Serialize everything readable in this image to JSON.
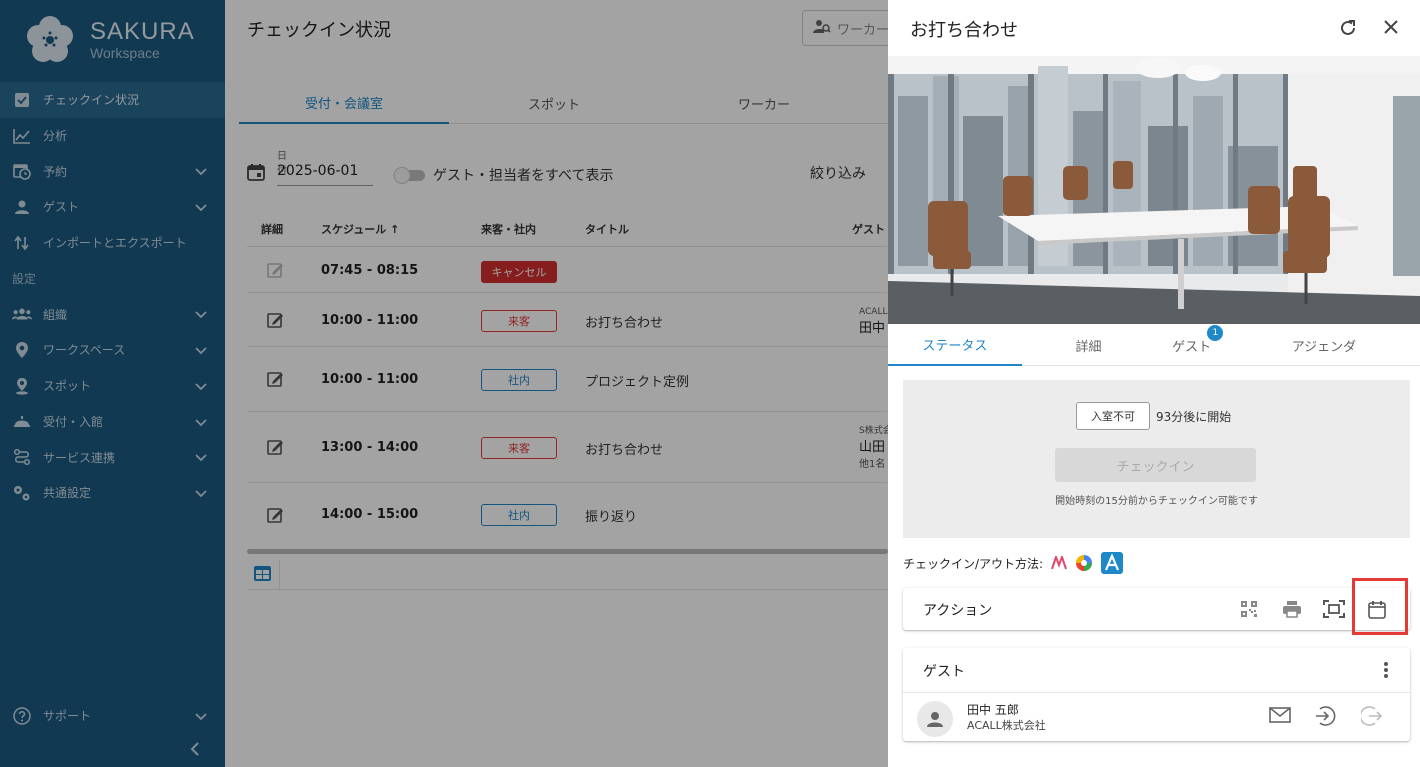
{
  "sidebar": {
    "brand": "SAKURA",
    "brand_sub": "Workspace",
    "items": [
      {
        "label": "チェックイン状況",
        "icon": "checkbox-icon",
        "active": true
      },
      {
        "label": "分析",
        "icon": "chart-line-icon"
      },
      {
        "label": "予約",
        "icon": "calendar-clock-icon",
        "expandable": true
      },
      {
        "label": "ゲスト",
        "icon": "people-icon",
        "expandable": true
      },
      {
        "label": "インポートとエクスポート",
        "icon": "import-export-icon"
      }
    ],
    "section_label": "設定",
    "settings_items": [
      {
        "label": "組織",
        "icon": "group-icon",
        "expandable": true
      },
      {
        "label": "ワークスペース",
        "icon": "location-pin-icon",
        "expandable": true
      },
      {
        "label": "スポット",
        "icon": "spot-pin-icon",
        "expandable": true
      },
      {
        "label": "受付・入館",
        "icon": "reception-bell-icon",
        "expandable": true
      },
      {
        "label": "サービス連携",
        "icon": "integration-icon",
        "expandable": true
      },
      {
        "label": "共通設定",
        "icon": "gears-icon",
        "expandable": true
      }
    ],
    "support_label": "サポート"
  },
  "main": {
    "title": "チェックイン状況",
    "worker_search_placeholder": "ワーカー",
    "tabs": [
      "受付・会議室",
      "スポット",
      "ワーカー"
    ],
    "date_label": "日付",
    "date_value": "2025-06-01",
    "toggle_label": "ゲスト・担当者をすべて表示",
    "filter_label": "絞り込み",
    "columns": {
      "detail": "詳細",
      "schedule": "スケジュール",
      "visit": "来客・社内",
      "title": "タイトル",
      "guest": "ゲスト"
    },
    "rows": [
      {
        "time": "07:45 - 08:15",
        "badge": "キャンセル",
        "title": "",
        "guest_company": "",
        "guest_name": "",
        "guest_more": ""
      },
      {
        "time": "10:00 - 11:00",
        "badge": "来客",
        "title": "お打ち合わせ",
        "guest_company": "ACALL",
        "guest_name": "田中",
        "guest_more": ""
      },
      {
        "time": "10:00 - 11:00",
        "badge": "社内",
        "title": "プロジェクト定例",
        "guest_company": "",
        "guest_name": "",
        "guest_more": ""
      },
      {
        "time": "13:00 - 14:00",
        "badge": "来客",
        "title": "お打ち合わせ",
        "guest_company": "S株式会",
        "guest_name": "山田",
        "guest_more": "他1名"
      },
      {
        "time": "14:00 - 15:00",
        "badge": "社内",
        "title": "振り返り",
        "guest_company": "",
        "guest_name": "",
        "guest_more": ""
      }
    ]
  },
  "drawer": {
    "title": "お打ち合わせ",
    "tabs": [
      "ステータス",
      "詳細",
      "ゲスト",
      "アジェンダ"
    ],
    "guest_tab_count": "1",
    "status": {
      "entry_state": "入室不可",
      "starts_in": "93分後に開始",
      "checkin_button": "チェックイン",
      "note": "開始時刻の15分前からチェックイン可能です"
    },
    "methods_label": "チェックイン/アウト方法:",
    "actions_title": "アクション",
    "guests_title": "ゲスト",
    "guest": {
      "name": "田中 五郎",
      "company": "ACALL株式会社"
    }
  },
  "colors": {
    "sidebar": "#1b5a80",
    "accent": "#2086c8",
    "cancel": "#d32f2f",
    "visitor": "#e53935",
    "highlight": "#e53935"
  }
}
